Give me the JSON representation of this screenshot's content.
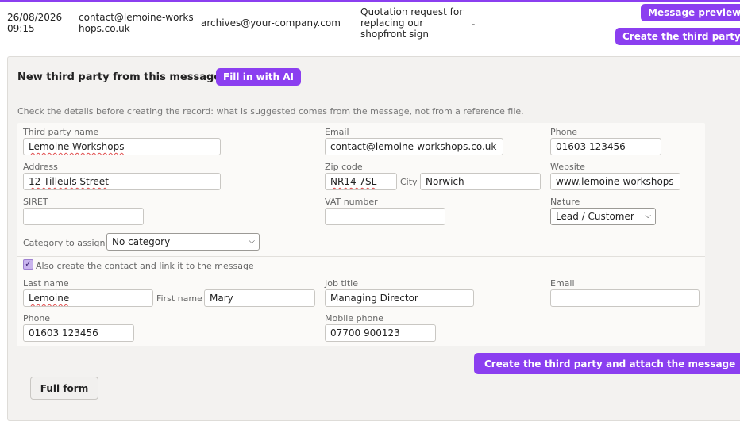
{
  "message": {
    "date": "26/08/2026 09:15",
    "from": "contact@lemoine-workshops.co.uk",
    "to": "archives@your-company.com",
    "subject": "Quotation request for replacing our shopfront sign",
    "extra": "-"
  },
  "actions": {
    "preview_label": "Message preview",
    "create_third_party_label": "Create the third party"
  },
  "panel": {
    "title": "New third party from this message",
    "ai_button": "Fill in with AI",
    "hint": "Check the details before creating the record: what is suggested comes from the message, not from a reference file."
  },
  "company": {
    "name_label": "Third party name",
    "name_value": "Lemoine Workshops",
    "email_label": "Email",
    "email_value": "contact@lemoine-workshops.co.uk",
    "phone_label": "Phone",
    "phone_value": "01603 123456",
    "address_label": "Address",
    "address_value": "12 Tilleuls Street",
    "zip_label": "Zip code",
    "zip_value": "NR14 7SL",
    "city_label": "City",
    "city_value": "Norwich",
    "website_label": "Website",
    "website_value": "www.lemoine-workshops",
    "siret_label": "SIRET",
    "siret_value": "",
    "vat_label": "VAT number",
    "vat_value": "",
    "nature_label": "Nature",
    "nature_value": "Lead / Customer",
    "category_label": "Category to assign",
    "category_value": "No category"
  },
  "contact": {
    "checkbox_checked": true,
    "checkbox_label": "Also create the contact and link it to the message",
    "lastname_label": "Last name",
    "lastname_value": "Lemoine",
    "firstname_label": "First name",
    "firstname_value": "Mary",
    "jobtitle_label": "Job title",
    "jobtitle_value": "Managing Director",
    "email_label": "Email",
    "email_value": "",
    "phone_label": "Phone",
    "phone_value": "01603 123456",
    "mobile_label": "Mobile phone",
    "mobile_value": "07700 900123"
  },
  "footer": {
    "submit_label": "Create the third party and attach the message",
    "full_form_label": "Full form"
  },
  "colors": {
    "accent": "#8b3ff0",
    "panel_bg": "#f3f2f0",
    "inner_bg": "#fbfaf8"
  }
}
